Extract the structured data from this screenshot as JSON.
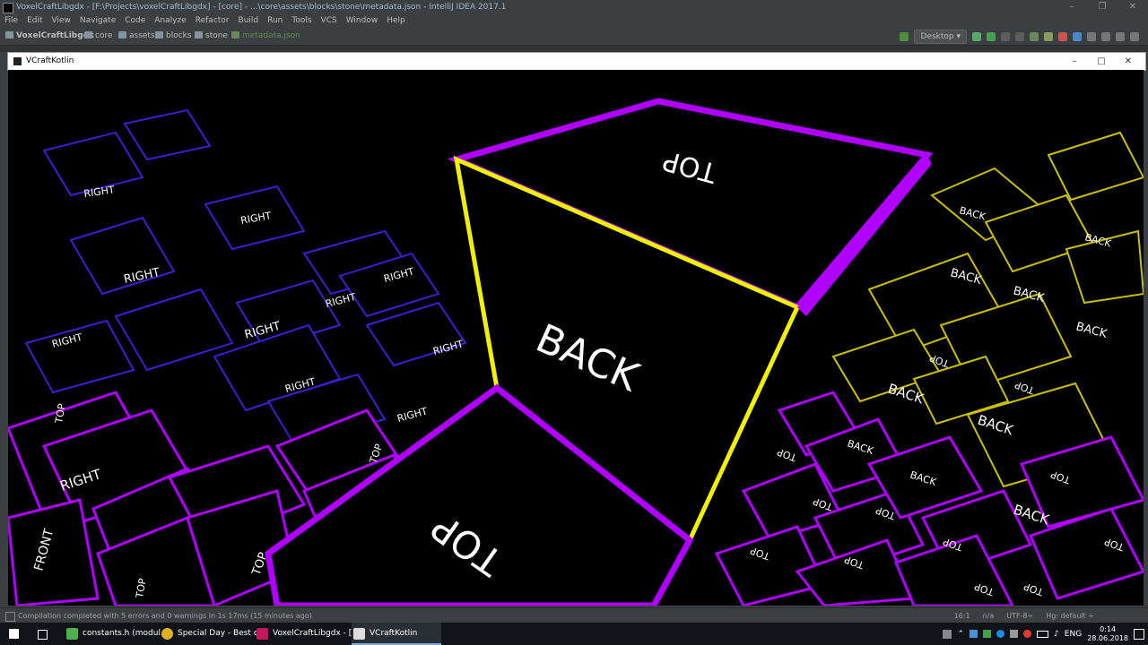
{
  "ide": {
    "window_title": "VoxelCraftLibgdx - [F:\\Projects\\voxelCraftLibgdx] - [core] - ...\\core\\assets\\blocks\\stone\\metadata.json - IntelliJ IDEA 2017.1",
    "menu": [
      "File",
      "Edit",
      "View",
      "Navigate",
      "Code",
      "Analyze",
      "Refactor",
      "Build",
      "Run",
      "Tools",
      "VCS",
      "Window",
      "Help"
    ],
    "breadcrumbs": [
      "VoxelCraftLibgdx",
      "core",
      "assets",
      "blocks",
      "stone",
      "metadata.json"
    ],
    "run_config": "Desktop",
    "status_message": "Compilation completed with 5 errors and 0 warnings in 1s 17ms (15 minutes ago)",
    "status_right": [
      "16:1",
      "n/a",
      "UTF-8÷",
      "Hg: default ÷"
    ]
  },
  "game": {
    "title": "VCraftKotlin",
    "face_labels": {
      "top": "TOP",
      "back": "BACK",
      "right": "RIGHT",
      "front": "FRONT"
    },
    "colors": {
      "magenta": "#b000ff",
      "yellow": "#f0f000",
      "black": "#000000",
      "white": "#ffffff"
    }
  },
  "taskbar": {
    "items": [
      "constants.h (modul...",
      "Special Day - Best o...",
      "VoxelCraftLibgdx - [...",
      "VCraftKotlin"
    ],
    "language": "ENG",
    "time": "0:14",
    "date": "28.06.2018"
  }
}
